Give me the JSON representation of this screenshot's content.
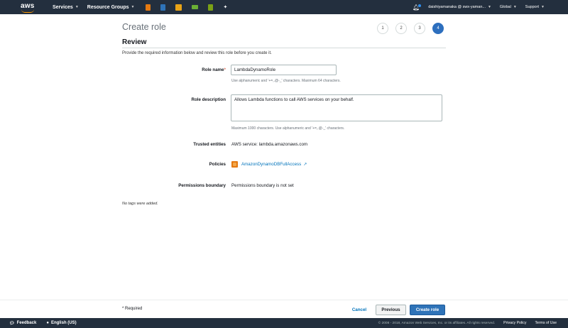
{
  "nav": {
    "logo": "aws",
    "services": "Services",
    "resource_groups": "Resource Groups",
    "service_icons": [
      {
        "name": "ec2-icon",
        "color": "#e47911"
      },
      {
        "name": "dynamodb-icon",
        "color": "#2e73b8"
      },
      {
        "name": "s3-icon",
        "color": "#e8a317"
      },
      {
        "name": "api-gateway-icon",
        "color": "#6aaf35"
      },
      {
        "name": "cloudformation-icon",
        "color": "#7aa116"
      },
      {
        "name": "pin-icon",
        "color": "#ffffff"
      }
    ],
    "account": "daishiyamanaka @ swx-yaman...",
    "region": "Global",
    "support": "Support"
  },
  "page": {
    "title": "Create role",
    "steps": [
      "1",
      "2",
      "3",
      "4"
    ],
    "active_step": "4",
    "section_title": "Review",
    "intro": "Provide the required information below and review this role before you create it."
  },
  "form": {
    "role_name_label": "Role name",
    "required_mark": "*",
    "role_name_value": "LambdaDynamoRole",
    "role_name_hint": "Use alphanumeric and '+=,.@-_' characters. Maximum 64 characters.",
    "role_description_label": "Role description",
    "role_description_value": "Allows Lambda functions to call AWS services on your behalf.",
    "role_description_hint": "Maximum 1000 characters. Use alphanumeric and '+=,.@-_' characters.",
    "trusted_entities_label": "Trusted entities",
    "trusted_entities_value": "AWS service: lambda.amazonaws.com",
    "policies_label": "Policies",
    "policy_name": "AmazonDynamoDBFullAccess",
    "permissions_boundary_label": "Permissions boundary",
    "permissions_boundary_value": "Permissions boundary is not set",
    "no_tags": "No tags were added."
  },
  "actions": {
    "required_note": "* Required",
    "cancel": "Cancel",
    "previous": "Previous",
    "create": "Create role"
  },
  "footer": {
    "feedback": "Feedback",
    "language": "English (US)",
    "copyright": "© 2008 - 2018, Amazon Web Services, Inc. or its affiliates. All rights reserved.",
    "privacy": "Privacy Policy",
    "terms": "Terms of Use"
  }
}
